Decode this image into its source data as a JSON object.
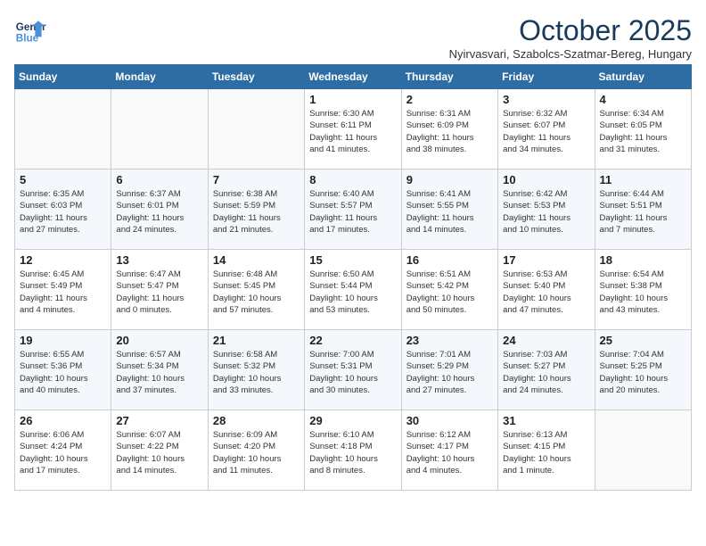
{
  "header": {
    "logo_line1": "General",
    "logo_line2": "Blue",
    "month": "October 2025",
    "location": "Nyirvasvari, Szabolcs-Szatmar-Bereg, Hungary"
  },
  "weekdays": [
    "Sunday",
    "Monday",
    "Tuesday",
    "Wednesday",
    "Thursday",
    "Friday",
    "Saturday"
  ],
  "weeks": [
    [
      {
        "day": "",
        "info": ""
      },
      {
        "day": "",
        "info": ""
      },
      {
        "day": "",
        "info": ""
      },
      {
        "day": "1",
        "info": "Sunrise: 6:30 AM\nSunset: 6:11 PM\nDaylight: 11 hours\nand 41 minutes."
      },
      {
        "day": "2",
        "info": "Sunrise: 6:31 AM\nSunset: 6:09 PM\nDaylight: 11 hours\nand 38 minutes."
      },
      {
        "day": "3",
        "info": "Sunrise: 6:32 AM\nSunset: 6:07 PM\nDaylight: 11 hours\nand 34 minutes."
      },
      {
        "day": "4",
        "info": "Sunrise: 6:34 AM\nSunset: 6:05 PM\nDaylight: 11 hours\nand 31 minutes."
      }
    ],
    [
      {
        "day": "5",
        "info": "Sunrise: 6:35 AM\nSunset: 6:03 PM\nDaylight: 11 hours\nand 27 minutes."
      },
      {
        "day": "6",
        "info": "Sunrise: 6:37 AM\nSunset: 6:01 PM\nDaylight: 11 hours\nand 24 minutes."
      },
      {
        "day": "7",
        "info": "Sunrise: 6:38 AM\nSunset: 5:59 PM\nDaylight: 11 hours\nand 21 minutes."
      },
      {
        "day": "8",
        "info": "Sunrise: 6:40 AM\nSunset: 5:57 PM\nDaylight: 11 hours\nand 17 minutes."
      },
      {
        "day": "9",
        "info": "Sunrise: 6:41 AM\nSunset: 5:55 PM\nDaylight: 11 hours\nand 14 minutes."
      },
      {
        "day": "10",
        "info": "Sunrise: 6:42 AM\nSunset: 5:53 PM\nDaylight: 11 hours\nand 10 minutes."
      },
      {
        "day": "11",
        "info": "Sunrise: 6:44 AM\nSunset: 5:51 PM\nDaylight: 11 hours\nand 7 minutes."
      }
    ],
    [
      {
        "day": "12",
        "info": "Sunrise: 6:45 AM\nSunset: 5:49 PM\nDaylight: 11 hours\nand 4 minutes."
      },
      {
        "day": "13",
        "info": "Sunrise: 6:47 AM\nSunset: 5:47 PM\nDaylight: 11 hours\nand 0 minutes."
      },
      {
        "day": "14",
        "info": "Sunrise: 6:48 AM\nSunset: 5:45 PM\nDaylight: 10 hours\nand 57 minutes."
      },
      {
        "day": "15",
        "info": "Sunrise: 6:50 AM\nSunset: 5:44 PM\nDaylight: 10 hours\nand 53 minutes."
      },
      {
        "day": "16",
        "info": "Sunrise: 6:51 AM\nSunset: 5:42 PM\nDaylight: 10 hours\nand 50 minutes."
      },
      {
        "day": "17",
        "info": "Sunrise: 6:53 AM\nSunset: 5:40 PM\nDaylight: 10 hours\nand 47 minutes."
      },
      {
        "day": "18",
        "info": "Sunrise: 6:54 AM\nSunset: 5:38 PM\nDaylight: 10 hours\nand 43 minutes."
      }
    ],
    [
      {
        "day": "19",
        "info": "Sunrise: 6:55 AM\nSunset: 5:36 PM\nDaylight: 10 hours\nand 40 minutes."
      },
      {
        "day": "20",
        "info": "Sunrise: 6:57 AM\nSunset: 5:34 PM\nDaylight: 10 hours\nand 37 minutes."
      },
      {
        "day": "21",
        "info": "Sunrise: 6:58 AM\nSunset: 5:32 PM\nDaylight: 10 hours\nand 33 minutes."
      },
      {
        "day": "22",
        "info": "Sunrise: 7:00 AM\nSunset: 5:31 PM\nDaylight: 10 hours\nand 30 minutes."
      },
      {
        "day": "23",
        "info": "Sunrise: 7:01 AM\nSunset: 5:29 PM\nDaylight: 10 hours\nand 27 minutes."
      },
      {
        "day": "24",
        "info": "Sunrise: 7:03 AM\nSunset: 5:27 PM\nDaylight: 10 hours\nand 24 minutes."
      },
      {
        "day": "25",
        "info": "Sunrise: 7:04 AM\nSunset: 5:25 PM\nDaylight: 10 hours\nand 20 minutes."
      }
    ],
    [
      {
        "day": "26",
        "info": "Sunrise: 6:06 AM\nSunset: 4:24 PM\nDaylight: 10 hours\nand 17 minutes."
      },
      {
        "day": "27",
        "info": "Sunrise: 6:07 AM\nSunset: 4:22 PM\nDaylight: 10 hours\nand 14 minutes."
      },
      {
        "day": "28",
        "info": "Sunrise: 6:09 AM\nSunset: 4:20 PM\nDaylight: 10 hours\nand 11 minutes."
      },
      {
        "day": "29",
        "info": "Sunrise: 6:10 AM\nSunset: 4:18 PM\nDaylight: 10 hours\nand 8 minutes."
      },
      {
        "day": "30",
        "info": "Sunrise: 6:12 AM\nSunset: 4:17 PM\nDaylight: 10 hours\nand 4 minutes."
      },
      {
        "day": "31",
        "info": "Sunrise: 6:13 AM\nSunset: 4:15 PM\nDaylight: 10 hours\nand 1 minute."
      },
      {
        "day": "",
        "info": ""
      }
    ]
  ]
}
